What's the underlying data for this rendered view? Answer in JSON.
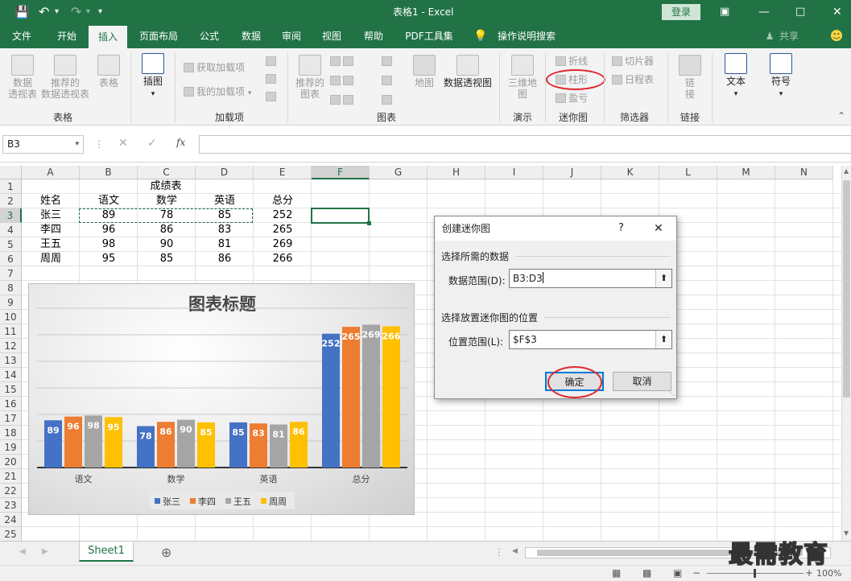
{
  "titlebar": {
    "title": "表格1 - Excel",
    "login": "登录"
  },
  "tabs": [
    "文件",
    "开始",
    "插入",
    "页面布局",
    "公式",
    "数据",
    "审阅",
    "视图",
    "帮助",
    "PDF工具集",
    "操作说明搜索"
  ],
  "share": "共享",
  "ribbon": {
    "groups": [
      "表格",
      "加载项",
      "图表",
      "演示",
      "迷你图",
      "筛选器",
      "链接"
    ],
    "table_buttons": [
      "数据\n透视表",
      "推荐的\n数据透视表",
      "表格"
    ],
    "illustration": "插图",
    "addins": [
      "获取加载项",
      "我的加载项"
    ],
    "chart_buttons": [
      "推荐的\n图表",
      "地图",
      "数据透视图"
    ],
    "tour": "三维地\n图",
    "sparklines": [
      "折线",
      "柱形",
      "盈亏"
    ],
    "filters": [
      "切片器",
      "日程表"
    ],
    "link": "链\n接",
    "text": "文本",
    "symbol": "符号"
  },
  "formula_bar": {
    "name_box": "B3",
    "fx": "fx"
  },
  "columns": [
    "A",
    "B",
    "C",
    "D",
    "E",
    "F",
    "G",
    "H",
    "I",
    "J",
    "K",
    "L",
    "M",
    "N"
  ],
  "rows": [
    "1",
    "2",
    "3",
    "4",
    "5",
    "6",
    "7",
    "8",
    "9",
    "10",
    "11",
    "12",
    "13",
    "14",
    "15",
    "16",
    "17",
    "18",
    "19",
    "20",
    "21",
    "22",
    "23",
    "24",
    "25"
  ],
  "table": {
    "title": "成绩表",
    "headers": [
      "姓名",
      "语文",
      "数学",
      "英语",
      "总分"
    ],
    "rows": [
      [
        "张三",
        "89",
        "78",
        "85",
        "252"
      ],
      [
        "李四",
        "96",
        "86",
        "83",
        "265"
      ],
      [
        "王五",
        "98",
        "90",
        "81",
        "269"
      ],
      [
        "周周",
        "95",
        "85",
        "86",
        "266"
      ]
    ]
  },
  "chart_data": {
    "type": "bar",
    "title": "图表标题",
    "categories": [
      "语文",
      "数学",
      "英语",
      "总分"
    ],
    "series": [
      {
        "name": "张三",
        "values": [
          89,
          78,
          85,
          252
        ],
        "color": "#4472c4"
      },
      {
        "name": "李四",
        "values": [
          96,
          86,
          83,
          265
        ],
        "color": "#ed7d31"
      },
      {
        "name": "王五",
        "values": [
          98,
          90,
          81,
          269
        ],
        "color": "#a5a5a5"
      },
      {
        "name": "周周",
        "values": [
          95,
          85,
          86,
          266
        ],
        "color": "#ffc000"
      }
    ],
    "ylim": [
      0,
      300
    ],
    "grid": true,
    "legend": "bottom",
    "data_labels": true
  },
  "dialog": {
    "title": "创建迷你图",
    "help": "?",
    "section1": "选择所需的数据",
    "data_range_label": "数据范围(D):",
    "data_range_value": "B3:D3",
    "section2": "选择放置迷你图的位置",
    "location_label": "位置范围(L):",
    "location_value": "$F$3",
    "ok": "确定",
    "cancel": "取消"
  },
  "sheet_tab": "Sheet1",
  "zoom": "100%",
  "watermark": "最需教育"
}
